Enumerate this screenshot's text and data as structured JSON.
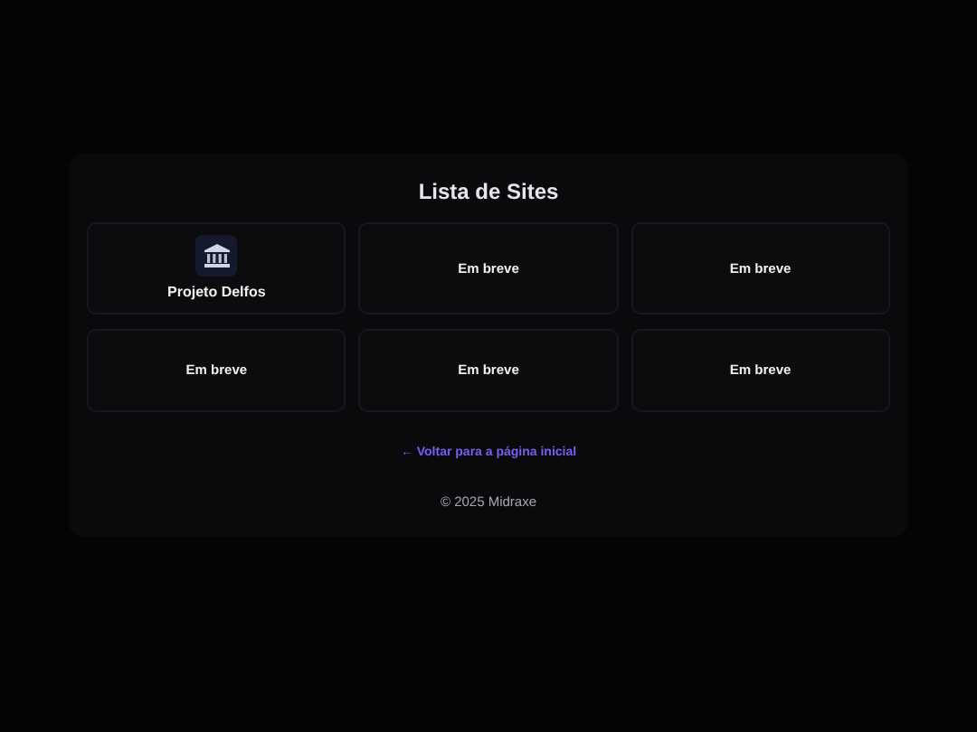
{
  "title": "Lista de Sites",
  "sites": [
    {
      "kind": "site",
      "label": "Projeto Delfos"
    },
    {
      "kind": "soon",
      "label": "Em breve"
    },
    {
      "kind": "soon",
      "label": "Em breve"
    },
    {
      "kind": "soon",
      "label": "Em breve"
    },
    {
      "kind": "soon",
      "label": "Em breve"
    },
    {
      "kind": "soon",
      "label": "Em breve"
    }
  ],
  "back_link": "← Voltar para a página inicial",
  "footer": "© 2025 Midraxe"
}
